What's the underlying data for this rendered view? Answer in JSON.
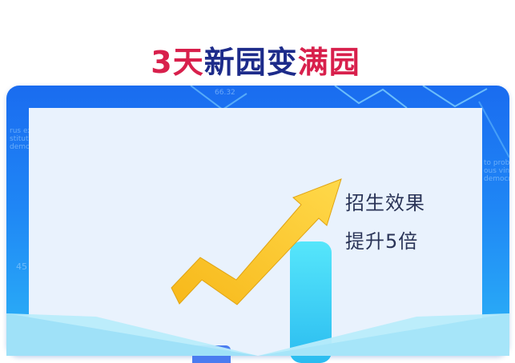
{
  "headline": {
    "part1": "3天",
    "part2": "新园变",
    "part3": "满园"
  },
  "subtitle": {
    "line1": "招生效果",
    "line2": "提升5倍"
  },
  "background_text": {
    "number_top": "66.32",
    "number_left": "45",
    "left_block": "rus ex\nstitutio\ndemocra",
    "right_block": "to probo\nous vinc\ndemocrati"
  },
  "colors": {
    "accent_red": "#d8204c",
    "navy": "#1d2b8a",
    "arrow_gold": "#f4c21b",
    "bar_cyan": "#35d4f4"
  }
}
